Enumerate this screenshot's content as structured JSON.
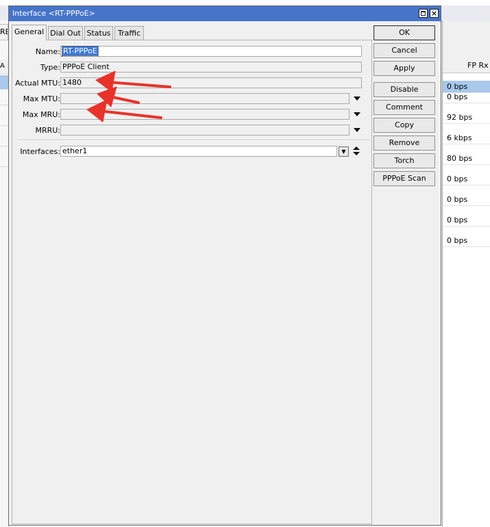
{
  "background": {
    "left_tab_stub": "RE",
    "left_column_stub": "A",
    "right_column_header": "FP Rx",
    "right_column_values": [
      "0 bps",
      "0 bps",
      "92 bps",
      "6 kbps",
      "80 bps",
      "0 bps",
      "0 bps",
      "0 bps",
      "0 bps"
    ]
  },
  "dialog": {
    "title": "Interface <RT-PPPoE>",
    "tabs": [
      "General",
      "Dial Out",
      "Status",
      "Traffic"
    ],
    "active_tab": "General",
    "fields": {
      "name": {
        "label": "Name:",
        "value": "RT-PPPoE"
      },
      "type": {
        "label": "Type:",
        "value": "PPPoE Client"
      },
      "actual_mtu": {
        "label": "Actual MTU:",
        "value": "1480"
      },
      "max_mtu": {
        "label": "Max MTU:",
        "value": ""
      },
      "max_mru": {
        "label": "Max MRU:",
        "value": ""
      },
      "mrru": {
        "label": "MRRU:",
        "value": ""
      },
      "interfaces": {
        "label": "Interfaces:",
        "value": "ether1"
      }
    },
    "buttons": [
      "OK",
      "Cancel",
      "Apply",
      "Disable",
      "Comment",
      "Copy",
      "Remove",
      "Torch",
      "PPPoE Scan"
    ]
  },
  "annotation_color": "#e8332a",
  "titlebar_color": "#4674c9"
}
